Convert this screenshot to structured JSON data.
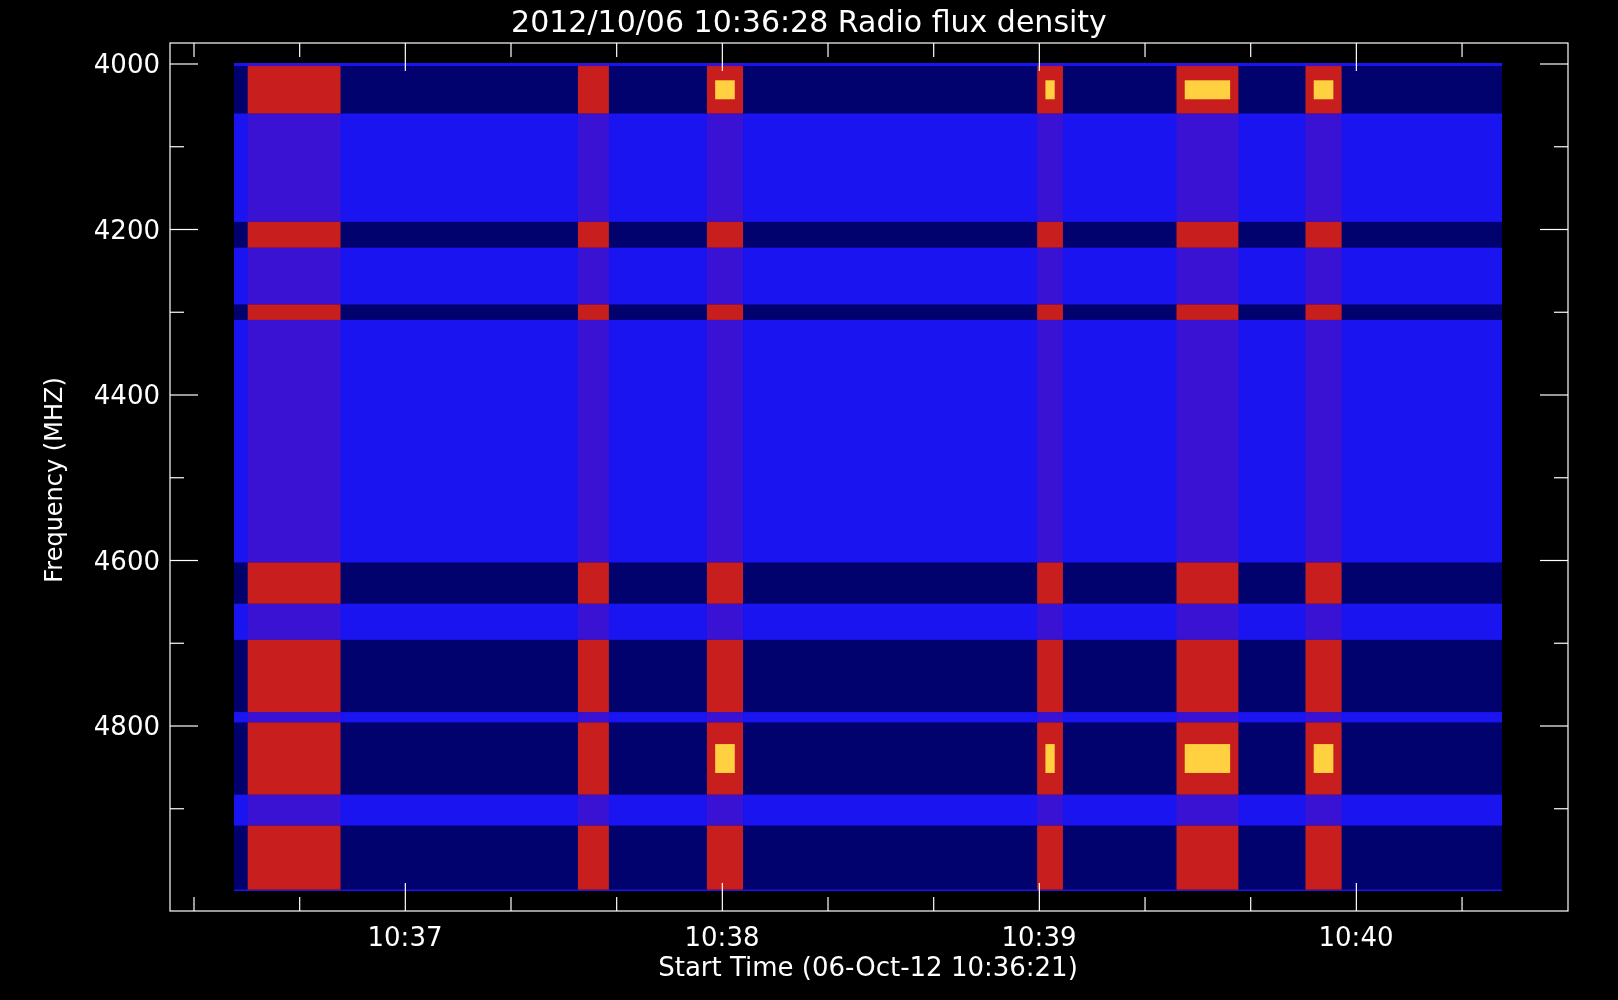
{
  "title": "2012/10/06 10:36:28 Radio flux density",
  "y_axis": {
    "label": "Frequency (MHZ)",
    "ticks": [
      "4000",
      "4200",
      "4400",
      "4600",
      "4800"
    ]
  },
  "x_axis": {
    "label": "Start Time (06-Oct-12 10:36:21)",
    "ticks": [
      "10:37",
      "10:38",
      "10:39",
      "10:40"
    ]
  }
}
